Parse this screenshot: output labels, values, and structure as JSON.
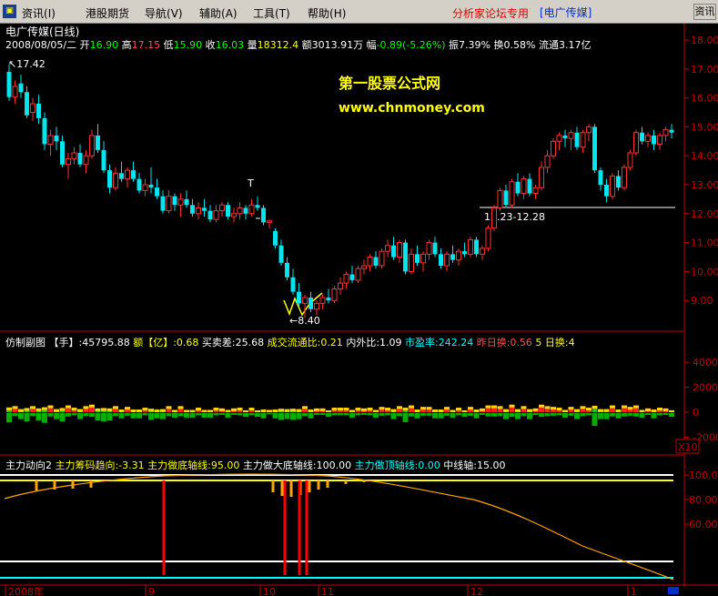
{
  "menu": {
    "items": [
      "资讯",
      "港股期货",
      "导航",
      "辅助",
      "工具",
      "帮助"
    ],
    "accel": [
      "(I)",
      "",
      "(V)",
      "(A)",
      "(T)",
      "(H)"
    ],
    "forum_label": "分析家论坛专用",
    "stock_bracket": "[电广传媒]",
    "info_button": "资讯"
  },
  "main_panel": {
    "title": "电广传媒(日线)",
    "date": "2008/08/05/二",
    "quote": [
      {
        "label": "开",
        "value": "16.90",
        "color": "#00ff00"
      },
      {
        "label": "高",
        "value": "17.15",
        "color": "#ff5050"
      },
      {
        "label": "低",
        "value": "15.90",
        "color": "#00ff00"
      },
      {
        "label": "收",
        "value": "16.03",
        "color": "#00ff00"
      },
      {
        "label": "量",
        "value": "18312.4",
        "color": "#ffff00"
      },
      {
        "label": "额",
        "value": "3013.91万",
        "color": "#ffffff"
      },
      {
        "label": "幅",
        "value": "-0.89(-5.26%)",
        "color": "#00ff00"
      },
      {
        "label": "振",
        "value": "7.39%",
        "color": "#ffffff"
      },
      {
        "label": "换",
        "value": "0.58%",
        "color": "#ffffff"
      },
      {
        "label": "流通",
        "value": "3.17亿",
        "color": "#ffffff"
      }
    ],
    "watermark_title": "第一股票公式网",
    "watermark_url": "www.chnmoney.com",
    "high_label": "17.42",
    "low_label": "8.40",
    "zone_label": "12.23-12.28",
    "marker_label": "T",
    "y_ticks": [
      "18.00",
      "17.00",
      "16.00",
      "15.00",
      "14.00",
      "13.00",
      "12.00",
      "11.00",
      "10.00",
      "9.00"
    ]
  },
  "volume_panel": {
    "items": [
      {
        "label": "仿制副图",
        "value": "",
        "color": "#ffffff"
      },
      {
        "label": "【手】",
        "value": ":45795.88",
        "color": "#ffffff"
      },
      {
        "label": "额【亿】",
        "value": ":0.68",
        "color": "#ffff00"
      },
      {
        "label": "买卖差",
        "value": ":25.68",
        "color": "#ffffff"
      },
      {
        "label": "成交流通比",
        "value": ":0.21",
        "color": "#ffff00"
      },
      {
        "label": "内外比",
        "value": ":1.09",
        "color": "#ffffff"
      },
      {
        "label": "市盈率",
        "value": ":242.24",
        "color": "#00ffff"
      },
      {
        "label": "昨日换",
        "value": ":0.56",
        "color": "#ff5050"
      },
      {
        "label": "5 日换",
        "value": ":4",
        "color": "#ffff00"
      }
    ],
    "y_ticks": [
      "40000",
      "20000",
      "0",
      "-20000"
    ],
    "scale_label": "X10"
  },
  "indicator_panel": {
    "items": [
      {
        "label": "主力动向2",
        "value": "",
        "color": "#ffffff"
      },
      {
        "label": "主力筹码趋向",
        "value": ":-3.31",
        "color": "#ffff00"
      },
      {
        "label": "主力做底轴线",
        "value": ":95.00",
        "color": "#ffff00"
      },
      {
        "label": "主力做大底轴线",
        "value": ":100.00",
        "color": "#ffffff"
      },
      {
        "label": "主力做顶轴线",
        "value": ":0.00",
        "color": "#00ffff"
      },
      {
        "label": "中线轴",
        "value": ":15.00",
        "color": "#ffffff"
      }
    ],
    "y_ticks": [
      "100.0",
      "80.00",
      "60.00"
    ]
  },
  "x_axis": {
    "labels": [
      "2008年",
      "9",
      "10",
      "11",
      "12",
      "1"
    ]
  },
  "colors": {
    "up": "#ff3030",
    "down": "#00e5ee",
    "axis": "#c00000",
    "menu_bg": "#d4d0c8"
  },
  "chart_data": {
    "type": "candlestick",
    "series": [
      {
        "name": "price",
        "values": [
          [
            16.9,
            17.15,
            15.9,
            16.03
          ],
          [
            16.03,
            16.6,
            15.8,
            16.4
          ],
          [
            16.5,
            16.8,
            16.0,
            16.2
          ],
          [
            16.2,
            16.4,
            15.3,
            15.4
          ],
          [
            15.5,
            16.0,
            15.2,
            15.8
          ],
          [
            15.8,
            16.1,
            15.1,
            15.3
          ],
          [
            15.3,
            15.5,
            14.2,
            14.4
          ],
          [
            14.4,
            14.9,
            14.0,
            14.7
          ],
          [
            14.7,
            15.0,
            14.2,
            14.5
          ],
          [
            14.5,
            14.7,
            13.6,
            13.7
          ],
          [
            13.7,
            14.1,
            13.2,
            13.9
          ],
          [
            13.9,
            14.3,
            13.7,
            14.1
          ],
          [
            14.1,
            14.4,
            13.6,
            13.7
          ],
          [
            13.7,
            14.2,
            13.4,
            14.0
          ],
          [
            14.0,
            14.9,
            13.9,
            14.7
          ],
          [
            14.7,
            15.1,
            14.1,
            14.2
          ],
          [
            14.2,
            14.5,
            13.4,
            13.5
          ],
          [
            13.5,
            13.7,
            12.7,
            12.9
          ],
          [
            12.9,
            13.6,
            12.8,
            13.4
          ],
          [
            13.4,
            13.8,
            13.1,
            13.2
          ],
          [
            13.2,
            13.6,
            12.9,
            13.5
          ],
          [
            13.5,
            13.8,
            13.1,
            13.2
          ],
          [
            13.2,
            13.4,
            12.7,
            12.8
          ],
          [
            12.8,
            13.2,
            12.6,
            13.0
          ],
          [
            13.0,
            13.6,
            12.7,
            12.9
          ],
          [
            12.9,
            13.2,
            12.5,
            12.6
          ],
          [
            12.6,
            12.8,
            12.0,
            12.1
          ],
          [
            12.1,
            12.8,
            12.0,
            12.6
          ],
          [
            12.6,
            12.7,
            12.1,
            12.3
          ],
          [
            12.3,
            12.7,
            11.9,
            12.5
          ],
          [
            12.5,
            12.8,
            12.2,
            12.3
          ],
          [
            12.3,
            12.5,
            11.9,
            12.0
          ],
          [
            12.0,
            12.4,
            11.8,
            12.2
          ],
          [
            12.2,
            12.5,
            11.9,
            12.1
          ],
          [
            12.1,
            12.3,
            11.7,
            11.8
          ],
          [
            11.8,
            12.3,
            11.7,
            12.1
          ],
          [
            12.1,
            12.4,
            11.9,
            12.3
          ],
          [
            12.3,
            12.4,
            11.8,
            11.9
          ],
          [
            11.9,
            12.2,
            11.7,
            12.0
          ],
          [
            12.0,
            12.4,
            11.8,
            12.2
          ],
          [
            12.2,
            12.3,
            11.8,
            12.0
          ],
          [
            12.0,
            12.5,
            11.9,
            12.3
          ],
          [
            12.3,
            12.6,
            12.1,
            12.2
          ],
          [
            12.2,
            12.3,
            11.6,
            11.7
          ],
          [
            11.7,
            11.8,
            11.5,
            11.75
          ],
          [
            11.4,
            11.5,
            10.8,
            10.9
          ],
          [
            10.9,
            11.1,
            10.2,
            10.3
          ],
          [
            10.3,
            10.5,
            9.7,
            9.8
          ],
          [
            9.8,
            10.1,
            9.2,
            9.3
          ],
          [
            9.3,
            9.6,
            8.8,
            8.9
          ],
          [
            8.9,
            9.2,
            8.4,
            9.1
          ],
          [
            9.1,
            9.3,
            8.6,
            8.7
          ],
          [
            8.7,
            9.0,
            8.5,
            8.9
          ],
          [
            8.9,
            9.2,
            8.7,
            9.1
          ],
          [
            9.1,
            9.4,
            8.9,
            9.0
          ],
          [
            9.0,
            9.5,
            8.9,
            9.4
          ],
          [
            9.4,
            9.8,
            9.2,
            9.6
          ],
          [
            9.6,
            10.0,
            9.4,
            9.9
          ],
          [
            9.9,
            10.2,
            9.6,
            9.7
          ],
          [
            9.7,
            10.2,
            9.6,
            10.1
          ],
          [
            10.1,
            10.4,
            9.9,
            10.2
          ],
          [
            10.2,
            10.6,
            10.0,
            10.5
          ],
          [
            10.5,
            10.7,
            10.1,
            10.2
          ],
          [
            10.2,
            10.8,
            10.1,
            10.7
          ],
          [
            10.7,
            11.1,
            10.5,
            10.9
          ],
          [
            10.9,
            11.2,
            10.4,
            10.5
          ],
          [
            10.5,
            11.1,
            10.3,
            11.0
          ],
          [
            11.0,
            11.1,
            9.9,
            10.0
          ],
          [
            10.0,
            10.8,
            9.9,
            10.6
          ],
          [
            10.6,
            10.9,
            10.2,
            10.3
          ],
          [
            10.3,
            10.7,
            10.0,
            10.6
          ],
          [
            10.6,
            11.1,
            10.4,
            11.0
          ],
          [
            11.0,
            11.2,
            10.5,
            10.6
          ],
          [
            10.6,
            10.8,
            10.1,
            10.2
          ],
          [
            10.2,
            10.7,
            10.0,
            10.6
          ],
          [
            10.6,
            10.9,
            10.3,
            10.4
          ],
          [
            10.4,
            10.8,
            10.2,
            10.7
          ],
          [
            10.7,
            11.0,
            10.5,
            10.6
          ],
          [
            10.6,
            11.2,
            10.5,
            11.1
          ],
          [
            11.1,
            11.2,
            10.5,
            10.6
          ],
          [
            10.6,
            10.9,
            10.4,
            10.8
          ],
          [
            10.8,
            11.6,
            10.7,
            11.5
          ],
          [
            11.5,
            12.3,
            11.4,
            12.2
          ],
          [
            12.2,
            12.9,
            12.1,
            12.8
          ],
          [
            12.8,
            13.0,
            12.2,
            12.3
          ],
          [
            12.3,
            13.2,
            12.2,
            13.1
          ],
          [
            13.1,
            13.4,
            12.6,
            12.7
          ],
          [
            12.7,
            13.3,
            12.5,
            13.2
          ],
          [
            13.2,
            13.4,
            12.6,
            12.7
          ],
          [
            12.7,
            13.0,
            12.5,
            12.9
          ],
          [
            12.9,
            13.8,
            12.8,
            13.6
          ],
          [
            13.6,
            14.2,
            13.4,
            14.0
          ],
          [
            14.0,
            14.6,
            13.9,
            14.5
          ],
          [
            14.5,
            14.8,
            14.2,
            14.7
          ],
          [
            14.7,
            14.9,
            14.3,
            14.6
          ],
          [
            14.6,
            14.9,
            14.2,
            14.8
          ],
          [
            14.8,
            15.0,
            14.2,
            14.3
          ],
          [
            14.3,
            14.9,
            14.1,
            14.8
          ],
          [
            14.8,
            15.1,
            14.5,
            15.0
          ],
          [
            15.0,
            15.1,
            13.4,
            13.5
          ],
          [
            13.5,
            13.6,
            12.8,
            13.0
          ],
          [
            13.0,
            13.2,
            12.4,
            12.6
          ],
          [
            12.6,
            13.4,
            12.5,
            13.3
          ],
          [
            13.3,
            13.5,
            12.8,
            12.9
          ],
          [
            12.9,
            13.7,
            12.8,
            13.6
          ],
          [
            13.6,
            14.2,
            13.5,
            14.1
          ],
          [
            14.1,
            14.9,
            14.0,
            14.8
          ],
          [
            14.8,
            15.0,
            14.4,
            14.5
          ],
          [
            14.5,
            14.8,
            14.3,
            14.7
          ],
          [
            14.7,
            14.9,
            14.2,
            14.4
          ],
          [
            14.4,
            14.8,
            14.2,
            14.7
          ],
          [
            14.7,
            15.0,
            14.5,
            14.9
          ],
          [
            14.9,
            15.1,
            14.6,
            14.8
          ]
        ]
      }
    ],
    "ylim": [
      8.3,
      18.4
    ],
    "gridlines": false
  }
}
